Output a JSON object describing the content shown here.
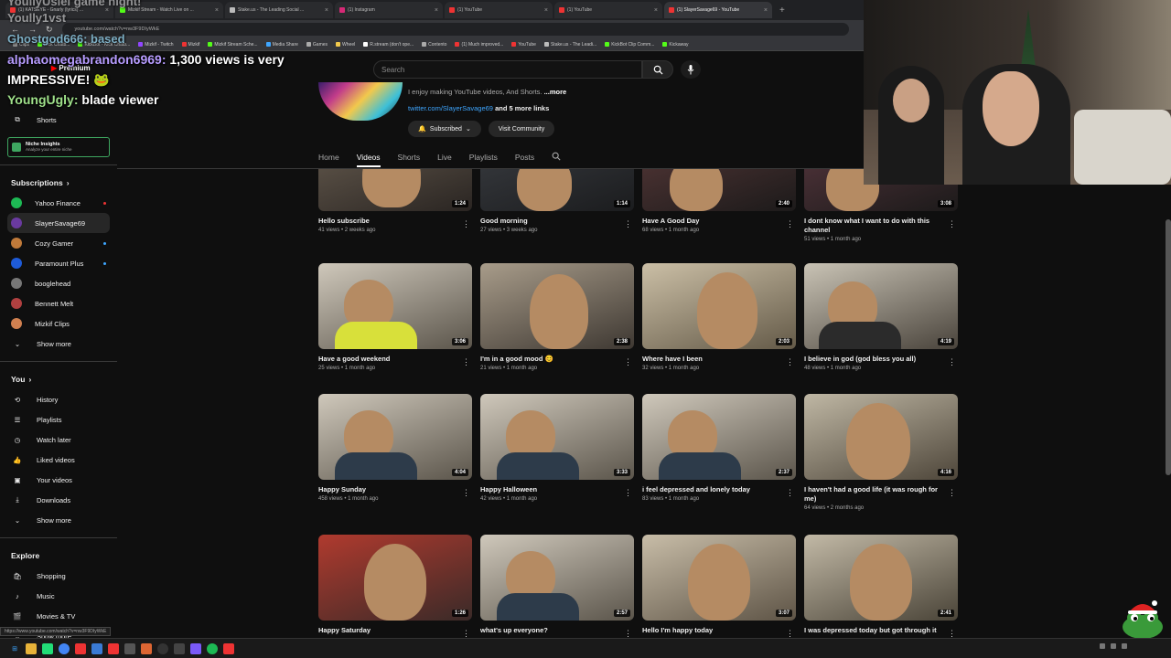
{
  "browser": {
    "tabs": [
      {
        "title": "(1) KATSEYE - Gnarly (lyrics) ..."
      },
      {
        "title": "Mizkif Stream - Watch Live on ..."
      },
      {
        "title": "Stake.us - The Leading Social ..."
      },
      {
        "title": "(1) Instagram"
      },
      {
        "title": "(1) YouTube"
      },
      {
        "title": "(1) YouTube"
      },
      {
        "title": "(1) SlayerSavage69 - YouTube"
      }
    ],
    "url": "youtube.com/watch?v=nw3F9DIyWkE",
    "bookmarks": [
      "Clips",
      "Kick Chatb...",
      "KickBot - Kick Chatb...",
      "Mizkif - Twitch",
      "Mizkif",
      "Mizkif Stream Sche...",
      "Media Share",
      "Games",
      "Wheel",
      "R.stream (don't ope...",
      "Contento",
      "(1) Much improved...",
      "YouTube",
      "Stake.us - The Leadi...",
      "KickBot Clip Comm...",
      "Kickaway"
    ]
  },
  "chat_overlay": {
    "line1": "YoullyUslei game night!",
    "line2": "Yoully1vst",
    "line3": "Ghostgod666: based",
    "line4_user": "alphaomegabrandon6969:",
    "line4_text": "1,300 views is very",
    "line5_text": "IMPRESSIVE!",
    "line6_user": "YoungUgly:",
    "line6_text": "blade viewer"
  },
  "youtube": {
    "logo": "Premium",
    "search_placeholder": "Search",
    "sidebar": {
      "shorts": "Shorts",
      "niche_title": "Niche Insights",
      "niche_sub": "Analyze your entire niche",
      "subscriptions_header": "Subscriptions",
      "subscriptions": [
        {
          "name": "Yahoo Finance",
          "color": "#1db954",
          "dot": "#e33"
        },
        {
          "name": "SlayerSavage69",
          "color": "#6a3aa0",
          "dot": ""
        },
        {
          "name": "Cozy Gamer",
          "color": "#c07a3a",
          "dot": "#3ea6ff"
        },
        {
          "name": "Paramount Plus",
          "color": "#1e5bd8",
          "dot": "#3ea6ff"
        },
        {
          "name": "booglehead",
          "color": "#777",
          "dot": ""
        },
        {
          "name": "Bennett Melt",
          "color": "#b04040",
          "dot": ""
        },
        {
          "name": "Mizkif Clips",
          "color": "#d08050",
          "dot": ""
        }
      ],
      "show_more": "Show more",
      "you_header": "You",
      "you_items": [
        "History",
        "Playlists",
        "Watch later",
        "Liked videos",
        "Your videos",
        "Downloads"
      ],
      "show_more2": "Show more",
      "explore_header": "Explore",
      "explore_items": [
        "Shopping",
        "Music",
        "Movies & TV"
      ],
      "show_more3": "Show more"
    },
    "channel": {
      "description": "I enjoy making YouTube videos, And Shorts.",
      "more": "...more",
      "link": "twitter.com/SlayerSavage69",
      "link_more": "and 5 more links",
      "subscribed": "Subscribed",
      "visit_community": "Visit Community",
      "tabs": [
        "Home",
        "Videos",
        "Shorts",
        "Live",
        "Playlists",
        "Posts"
      ],
      "active_tab": "Videos"
    },
    "videos": [
      {
        "title": "Hello subscribe",
        "meta": "41 views • 2 weeks ago",
        "duration": "1:24"
      },
      {
        "title": "Good morning",
        "meta": "27 views • 3 weeks ago",
        "duration": "1:14"
      },
      {
        "title": "Have A Good Day",
        "meta": "68 views • 1 month ago",
        "duration": "2:40"
      },
      {
        "title": "I dont know what I want to do with this channel",
        "meta": "51 views • 1 month ago",
        "duration": "3:08"
      },
      {
        "title": "Have a good weekend",
        "meta": "25 views • 1 month ago",
        "duration": "3:06"
      },
      {
        "title": "I'm in a good mood 😊",
        "meta": "21 views • 1 month ago",
        "duration": "2:38"
      },
      {
        "title": "Where have I been",
        "meta": "32 views • 1 month ago",
        "duration": "2:03"
      },
      {
        "title": "I believe in god (god bless you all)",
        "meta": "48 views • 1 month ago",
        "duration": "4:19"
      },
      {
        "title": "Happy Sunday",
        "meta": "458 views • 1 month ago",
        "duration": "4:04"
      },
      {
        "title": "Happy Halloween",
        "meta": "42 views • 1 month ago",
        "duration": "3:33"
      },
      {
        "title": "i feel depressed and lonely today",
        "meta": "83 views • 1 month ago",
        "duration": "2:37"
      },
      {
        "title": "I haven't had a good life (it was rough for me)",
        "meta": "64 views • 2 months ago",
        "duration": "4:16"
      },
      {
        "title": "Happy Saturday",
        "meta": "",
        "duration": "1:26"
      },
      {
        "title": "what's up everyone?",
        "meta": "",
        "duration": "2:57"
      },
      {
        "title": "Hello I'm happy today",
        "meta": "",
        "duration": "3:07"
      },
      {
        "title": "I was depressed today but got through it",
        "meta": "",
        "duration": "2:41"
      }
    ]
  },
  "status_url": "https://www.youtube.com/watch?v=nw3F9DIyWkE"
}
